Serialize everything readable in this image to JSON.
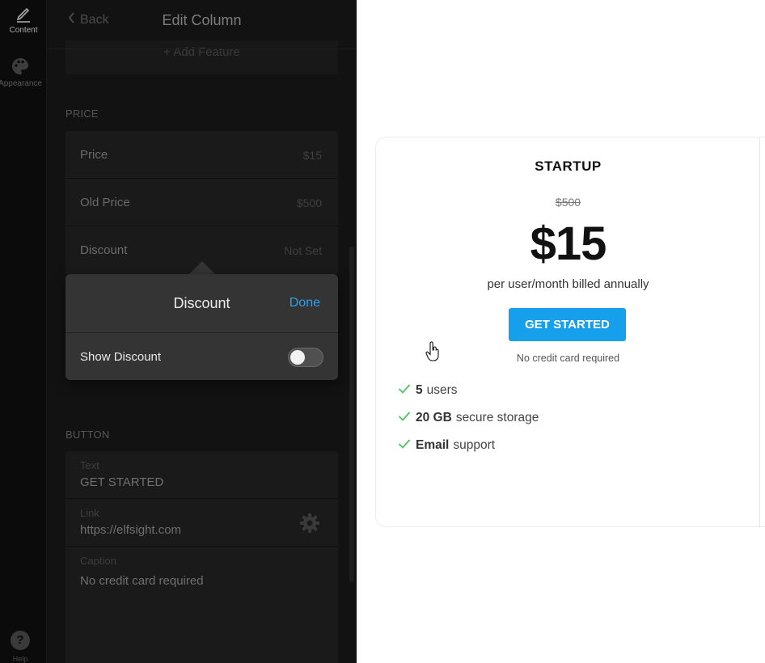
{
  "rail": {
    "content_label": "Content",
    "appearance_label": "Appearance",
    "help_label": "Help"
  },
  "panel": {
    "back_label": "Back",
    "title": "Edit Column",
    "add_feature_label": "+ Add Feature",
    "price_section_label": "PRICE",
    "price_rows": [
      {
        "label": "Price",
        "value": "$15"
      },
      {
        "label": "Old Price",
        "value": "$500"
      },
      {
        "label": "Discount",
        "value": "Not Set"
      }
    ],
    "button_section_label": "BUTTON",
    "button_fields": [
      {
        "caption": "Text",
        "value": "GET STARTED"
      },
      {
        "caption": "Link",
        "value": "https://elfsight.com"
      },
      {
        "caption": "Caption",
        "value": "No credit card required"
      }
    ]
  },
  "popover": {
    "title": "Discount",
    "done_label": "Done",
    "show_discount_label": "Show Discount",
    "show_discount_on": false
  },
  "card": {
    "plan_name": "STARTUP",
    "old_price": "$500",
    "price": "$15",
    "period": "per user/month billed annually",
    "cta_label": "GET STARTED",
    "caption": "No credit card required",
    "features": [
      {
        "bold": "5",
        "text": "users"
      },
      {
        "bold": "20 GB",
        "text": "secure storage"
      },
      {
        "bold": "Email",
        "text": "support"
      }
    ],
    "accent_color": "#16a0ec",
    "check_color": "#4cc35c"
  }
}
